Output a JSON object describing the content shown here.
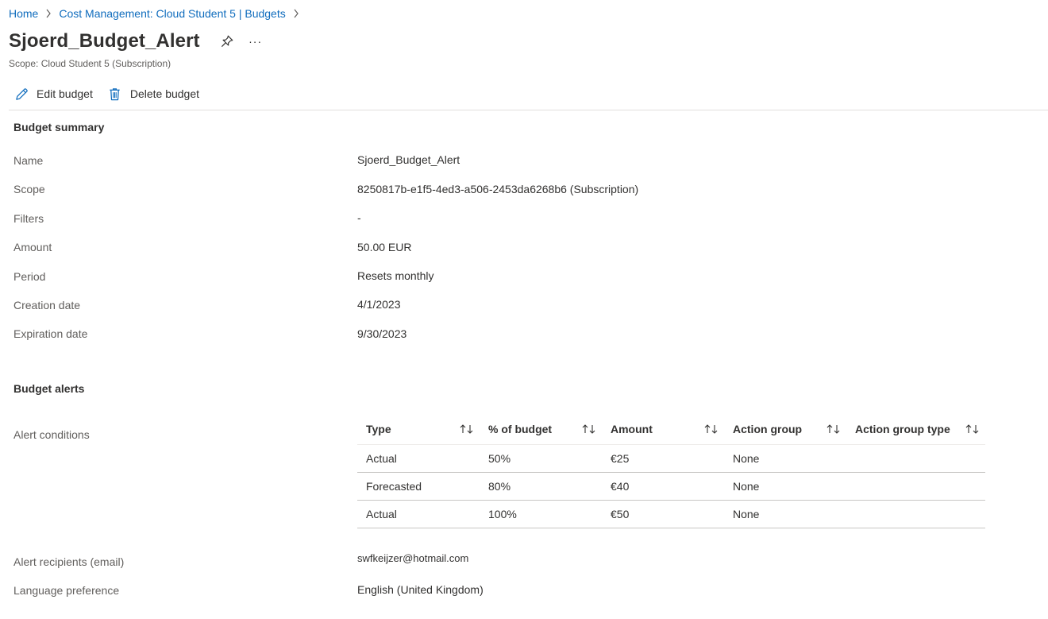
{
  "breadcrumb": {
    "items": [
      "Home",
      "Cost Management: Cloud Student 5 | Budgets"
    ]
  },
  "header": {
    "title": "Sjoerd_Budget_Alert",
    "more_label": "···",
    "scope": "Scope: Cloud Student 5 (Subscription)"
  },
  "toolbar": {
    "edit_label": "Edit budget",
    "delete_label": "Delete budget"
  },
  "summary": {
    "title": "Budget summary",
    "rows": [
      {
        "label": "Name",
        "value": "Sjoerd_Budget_Alert"
      },
      {
        "label": "Scope",
        "value": "8250817b-e1f5-4ed3-a506-2453da6268b6 (Subscription)"
      },
      {
        "label": "Filters",
        "value": "-"
      },
      {
        "label": "Amount",
        "value": "50.00 EUR"
      },
      {
        "label": "Period",
        "value": "Resets monthly"
      },
      {
        "label": "Creation date",
        "value": "4/1/2023"
      },
      {
        "label": "Expiration date",
        "value": "9/30/2023"
      }
    ]
  },
  "alerts": {
    "title": "Budget alerts",
    "conditions_label": "Alert conditions",
    "columns": [
      "Type",
      "% of budget",
      "Amount",
      "Action group",
      "Action group type"
    ],
    "rows": [
      [
        "Actual",
        "50%",
        "€25",
        "None",
        ""
      ],
      [
        "Forecasted",
        "80%",
        "€40",
        "None",
        ""
      ],
      [
        "Actual",
        "100%",
        "€50",
        "None",
        ""
      ]
    ],
    "recipients_label": "Alert recipients (email)",
    "recipients_value": "swfkeijzer@hotmail.com",
    "language_label": "Language preference",
    "language_value": "English (United Kingdom)"
  },
  "colors": {
    "link": "#0f6cbd",
    "text": "#323130",
    "label": "#605e5c",
    "divider": "#e1dfdd"
  }
}
